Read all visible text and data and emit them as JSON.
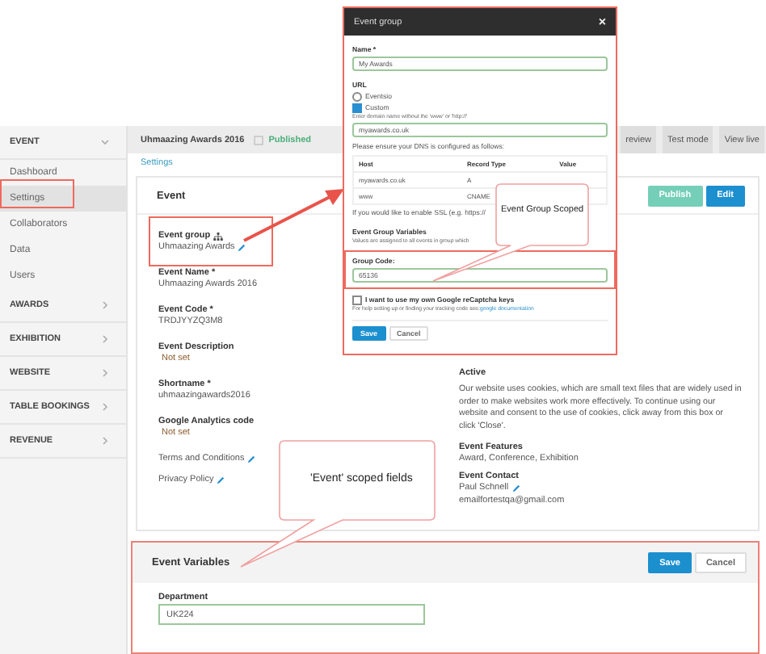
{
  "sidebar": {
    "sections": [
      {
        "label": "EVENT",
        "expanded": true,
        "items": [
          {
            "label": "Dashboard",
            "selected": false
          },
          {
            "label": "Settings",
            "selected": true
          },
          {
            "label": "Collaborators",
            "selected": false
          },
          {
            "label": "Data",
            "selected": false
          },
          {
            "label": "Users",
            "selected": false
          }
        ]
      },
      {
        "label": "AWARDS",
        "expanded": false
      },
      {
        "label": "EXHIBITION",
        "expanded": false
      },
      {
        "label": "WEBSITE",
        "expanded": false
      },
      {
        "label": "TABLE BOOKINGS",
        "expanded": false
      },
      {
        "label": "REVENUE",
        "expanded": false
      }
    ]
  },
  "header": {
    "event_title": "Uhmaazing Awards 2016",
    "status": "Published",
    "buttons": [
      "review",
      "Test mode",
      "View live"
    ]
  },
  "breadcrumb": "Settings",
  "event_card": {
    "title": "Event",
    "buttons": [
      {
        "label": "Publish",
        "kind": "secondary"
      },
      {
        "label": "Edit",
        "kind": "primary"
      }
    ],
    "fields": [
      {
        "label": "Event group",
        "kind": "group",
        "value": "Uhmaazing Awards",
        "editable": true
      },
      {
        "label": "Event Name *",
        "kind": "text",
        "value": "Uhmaazing Awards 2016",
        "editable": false
      },
      {
        "label": "Event Code *",
        "kind": "text",
        "value": "TRDJYYZQ3M8",
        "editable": false
      },
      {
        "label": "Event Description",
        "kind": "unset",
        "value": "Not set",
        "editable": false
      },
      {
        "label": "Shortname *",
        "kind": "text",
        "value": "uhmaazingawards2016",
        "editable": false
      },
      {
        "label": "Google Analytics code",
        "kind": "unset",
        "value": "Not set",
        "editable": false
      },
      {
        "label": "Terms and Conditions",
        "kind": "link",
        "editable": true
      },
      {
        "label": "Privacy Policy",
        "kind": "link",
        "editable": true
      }
    ],
    "status_text": "Active",
    "cookie_notice": "Our website uses cookies, which are small text files that are widely used in order to make websites work more effectively. To continue using our website and consent to the use of cookies, click away from this box or click 'Close'.",
    "right_fields": [
      {
        "label": "Event Features",
        "value": "Award, Conference, Exhibition",
        "editable": false
      },
      {
        "label": "Event Contact",
        "value": "Paul Schnell",
        "editable": true,
        "extra": "emailfortestqa@gmail.com"
      }
    ]
  },
  "variables_panel": {
    "title": "Event Variables",
    "buttons": [
      {
        "label": "Save",
        "kind": "primary"
      },
      {
        "label": "Cancel",
        "kind": "default"
      }
    ],
    "field": {
      "label": "Department",
      "value": "UK224"
    }
  },
  "dialog": {
    "title": "Event group",
    "close": "×",
    "name_label": "Name *",
    "name_value": "My Awards",
    "url_label": "URL",
    "url_options": [
      {
        "label": "Eventsio",
        "kind": "radio",
        "checked": false
      },
      {
        "label": "Custom",
        "kind": "checkbox",
        "checked": true
      }
    ],
    "domain_hint": "Enter domain name without the 'www' or 'http://'",
    "domain_value": "myawards.co.uk",
    "dns_note": "Please ensure your DNS is configured as follows:",
    "dns_columns": [
      "Host",
      "Record Type",
      "Value"
    ],
    "dns_rows": [
      [
        "myawards.co.uk",
        "A"
      ],
      [
        "www",
        "CNAME"
      ]
    ],
    "ssl_note": "If you would like to enable SSL (e.g. https://",
    "variables_title": "Event Group Variables",
    "variables_note": "Values are assigned to all events in group which",
    "group_code_label": "Group Code:",
    "group_code_value": "65136",
    "recaptcha_label": "I want to use my own Google reCaptcha keys",
    "recaptcha_checked": false,
    "help_text": "For help setting up or finding your tracking code see:",
    "help_link": "google documentation",
    "buttons": [
      {
        "label": "Save",
        "kind": "primary"
      },
      {
        "label": "Cancel",
        "kind": "default"
      }
    ]
  },
  "annotations": [
    {
      "text": "Event Group Scoped"
    },
    {
      "text": "'Event' scoped fields"
    }
  ]
}
